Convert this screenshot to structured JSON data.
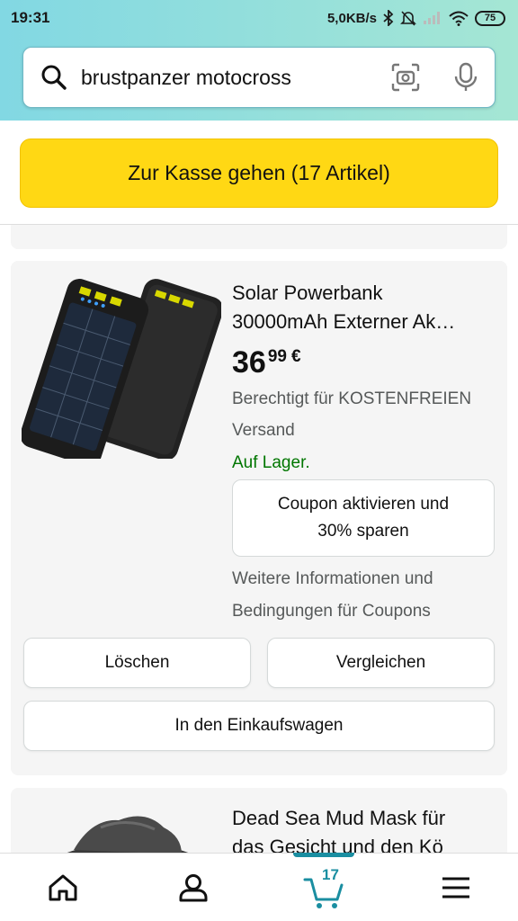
{
  "status_bar": {
    "time": "19:31",
    "network_speed": "5,0KB/s",
    "battery": "75",
    "icons": [
      "bluetooth-icon",
      "mute-icon",
      "signal-icon",
      "wifi-icon",
      "battery-icon"
    ]
  },
  "search": {
    "query": "brustpanzer motocross",
    "icons": [
      "search-icon",
      "camera-scan-icon",
      "microphone-icon"
    ]
  },
  "checkout": {
    "label": "Zur Kasse gehen (17 Artikel)"
  },
  "product": {
    "title_line1": "Solar Powerbank",
    "title_line2": "30000mAh Externer Ak…",
    "price_whole": "36",
    "price_fraction": "99",
    "currency": "€",
    "shipping_line1": "Berechtigt für KOSTENFREIEN",
    "shipping_line2": "Versand",
    "stock": "Auf Lager.",
    "coupon_line1": "Coupon aktivieren und",
    "coupon_line2": "30% sparen",
    "coupon_info_line1": "Weitere Informationen und",
    "coupon_info_line2": "Bedingungen für Coupons",
    "delete_label": "Löschen",
    "compare_label": "Vergleichen",
    "add_to_cart_label": "In den Einkaufswagen"
  },
  "next_product": {
    "title_line1": "Dead Sea Mud Mask für",
    "title_line2": "das Gesicht und den Kö"
  },
  "bottom_nav": {
    "items": [
      "home-icon",
      "account-icon",
      "cart-icon",
      "menu-icon"
    ],
    "cart_count": "17",
    "active": "cart"
  },
  "colors": {
    "checkout_button": "#ffd814",
    "in_stock": "#007600",
    "accent": "#1a8ea1",
    "header_gradient_start": "#82d8e3",
    "header_gradient_end": "#a5e6d4"
  }
}
